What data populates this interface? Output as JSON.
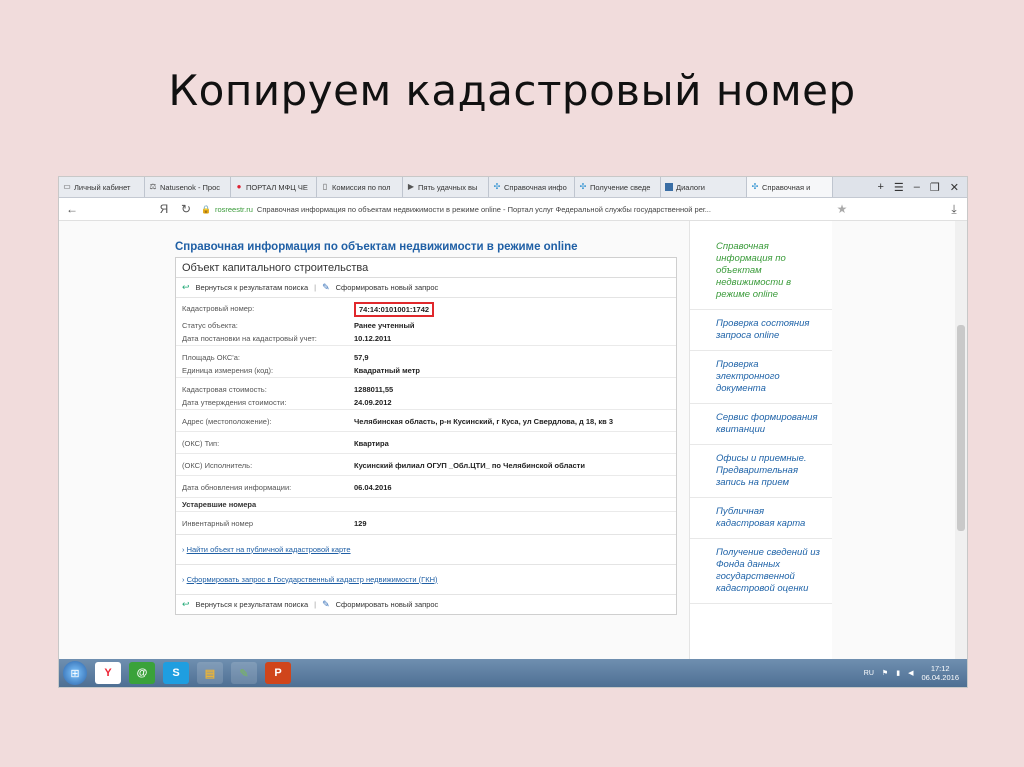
{
  "slide": {
    "title": "Копируем кадастровый номер"
  },
  "browser": {
    "tabs": [
      {
        "icon": "page-icon",
        "label": "Личный кабинет"
      },
      {
        "icon": "scales-icon",
        "label": "Natusenok - Прос"
      },
      {
        "icon": "portal-icon",
        "label": "ПОРТАЛ МФЦ ЧЕ"
      },
      {
        "icon": "document-icon",
        "label": "Комиссия по пол"
      },
      {
        "icon": "play-icon",
        "label": "Пять удачных вы"
      },
      {
        "icon": "site-icon",
        "label": "Справочная инфо"
      },
      {
        "icon": "site-icon",
        "label": "Получение сведе"
      },
      {
        "icon": "dialog-icon",
        "label": "Диалоги"
      },
      {
        "icon": "site-icon",
        "label": "Справочная и"
      }
    ],
    "tab_tools": {
      "new_tab": "+",
      "menu": "☰",
      "minimize": "–",
      "restore": "❐",
      "close": "✕"
    },
    "address": {
      "back": "←",
      "ya": "Я",
      "reload": "↻",
      "domain": "rosreestr.ru",
      "title": "Справочная информация по объектам недвижимости в режиме online - Портал услуг Федеральной службы государственной рег...",
      "star": "★",
      "download": "⤓"
    }
  },
  "page": {
    "heading": "Справочная информация по объектам недвижимости в режиме online",
    "panel_title": "Объект капитального строительства",
    "actions": {
      "back": "Вернуться к результатам поиска",
      "new_request": "Сформировать новый запрос",
      "separator": "|"
    },
    "rows": [
      {
        "label": "Кадастровый номер:",
        "value": "74:14:0101001:1742",
        "highlight": true
      },
      {
        "label": "Статус объекта:",
        "value": "Ранее учтенный"
      },
      {
        "label": "Дата постановки на кадастровый учет:",
        "value": "10.12.2011"
      },
      {
        "label": "Площадь ОКС'а:",
        "value": "57,9"
      },
      {
        "label": "Единица измерения (код):",
        "value": "Квадратный метр"
      },
      {
        "label": "Кадастровая стоимость:",
        "value": "1288011,55"
      },
      {
        "label": "Дата утверждения стоимости:",
        "value": "24.09.2012"
      },
      {
        "label": "Адрес (местоположение):",
        "value": "Челябинская область, р-н Кусинский, г Куса, ул Свердлова, д 18, кв 3"
      },
      {
        "label": "(ОКС) Тип:",
        "value": "Квартира"
      },
      {
        "label": "(ОКС) Исполнитель:",
        "value": "Кусинский филиал ОГУП _Обл.ЦТИ_ по Челябинской области"
      },
      {
        "label": "Дата обновления информации:",
        "value": "06.04.2016"
      }
    ],
    "obsolete_section": "Устаревшие номера",
    "inventory": {
      "label": "Инвентарный номер",
      "value": "129"
    },
    "link_map": "Найти объект на публичной кадастровой карте",
    "link_gkn": "Сформировать запрос в Государственный кадастр недвижимости (ГКН)"
  },
  "sidebar": [
    "Справочная информация по объектам недвижимости в режиме online",
    "Проверка состояния запроса online",
    "Проверка электронного документа",
    "Сервис формирования квитанции",
    "Офисы и приемные. Предварительная запись на прием",
    "Публичная кадастровая карта",
    "Получение сведений из Фонда данных государственной кадастровой оценки"
  ],
  "taskbar": {
    "apps": [
      "yandex-browser",
      "icq",
      "skype",
      "file-explorer",
      "paint",
      "powerpoint"
    ],
    "lang": "RU",
    "time": "17:12",
    "date": "06.04.2016"
  }
}
